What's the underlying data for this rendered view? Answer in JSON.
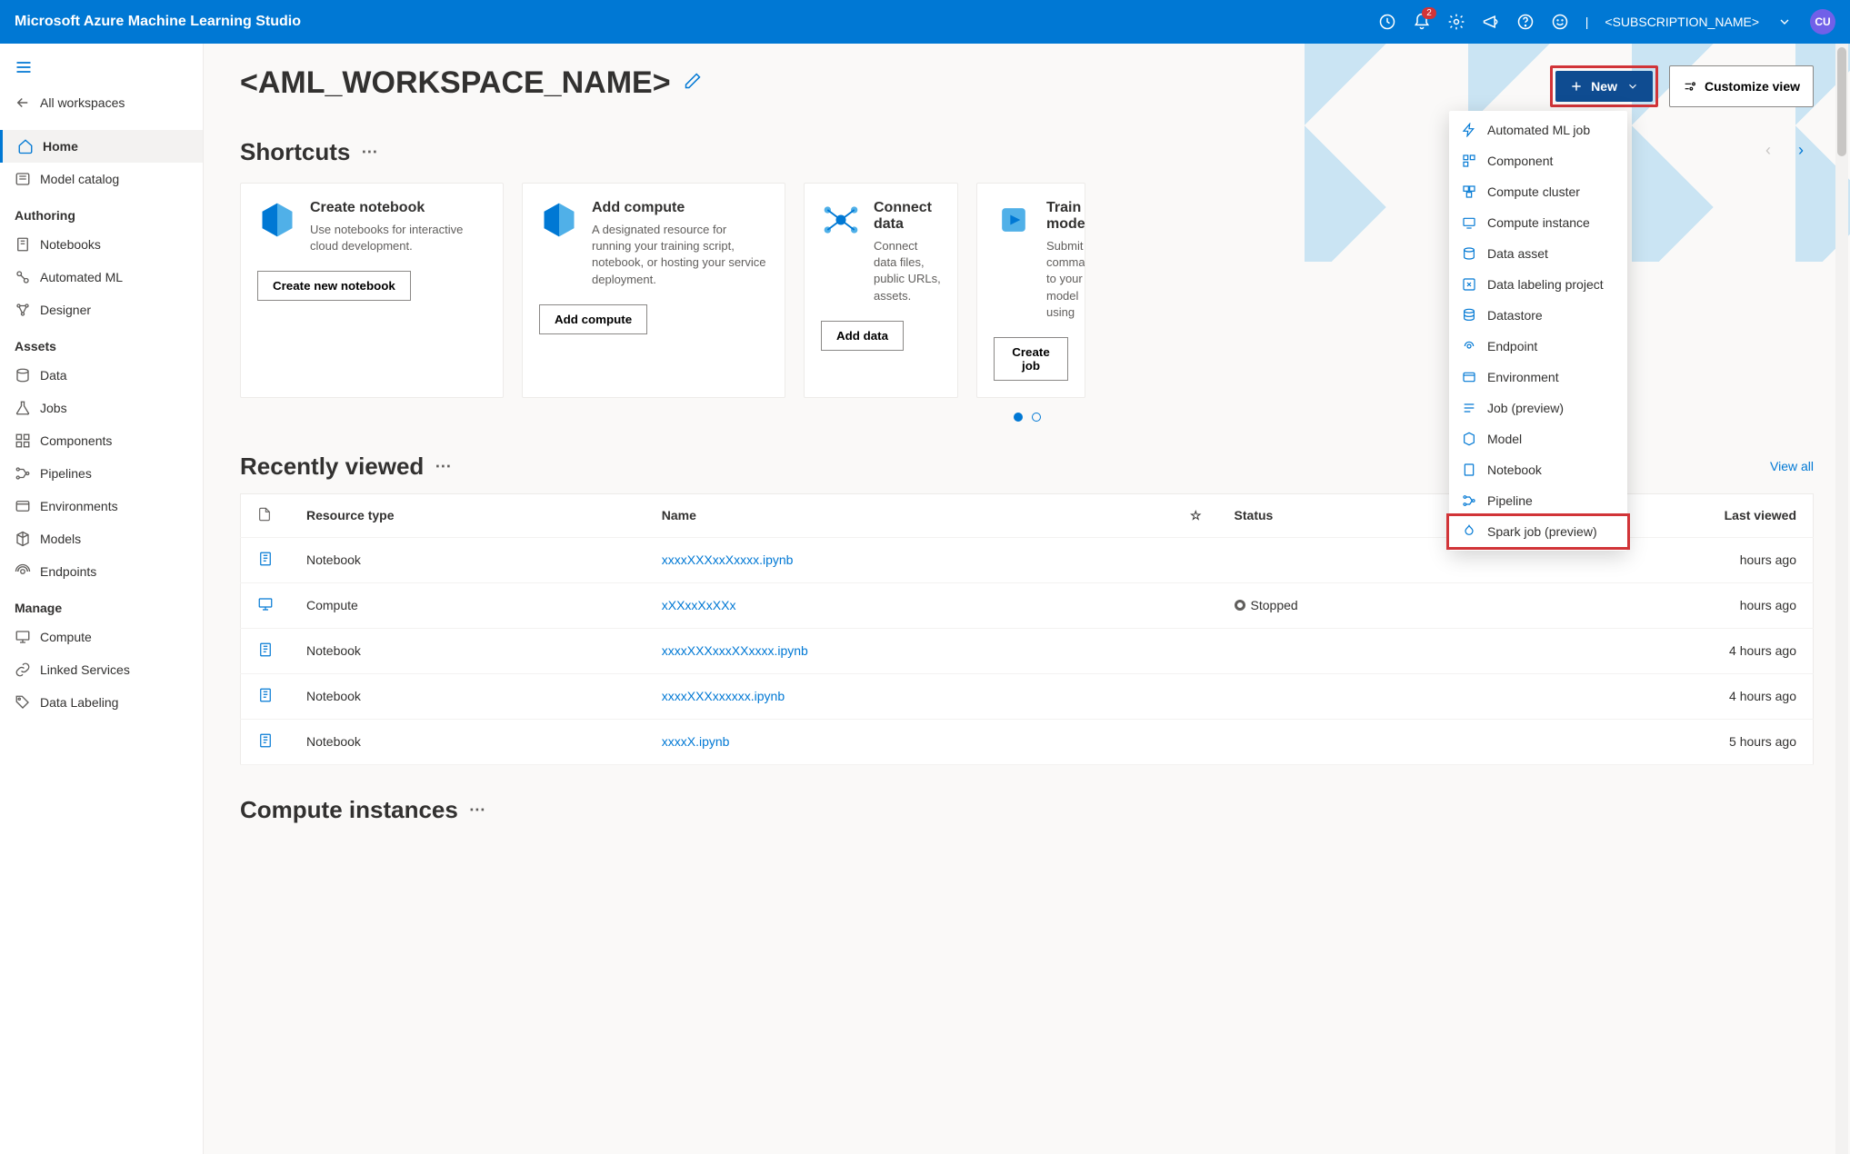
{
  "topbar": {
    "title": "Microsoft Azure Machine Learning Studio",
    "notification_count": "2",
    "subscription": "<SUBSCRIPTION_NAME>",
    "avatar_initials": "CU"
  },
  "sidebar": {
    "back": "All workspaces",
    "home": "Home",
    "model_catalog": "Model catalog",
    "groups": {
      "authoring": {
        "title": "Authoring",
        "items": [
          "Notebooks",
          "Automated ML",
          "Designer"
        ]
      },
      "assets": {
        "title": "Assets",
        "items": [
          "Data",
          "Jobs",
          "Components",
          "Pipelines",
          "Environments",
          "Models",
          "Endpoints"
        ]
      },
      "manage": {
        "title": "Manage",
        "items": [
          "Compute",
          "Linked Services",
          "Data Labeling"
        ]
      }
    }
  },
  "workspace": {
    "name": "<AML_WORKSPACE_NAME>"
  },
  "buttons": {
    "new": "New",
    "customize": "Customize view"
  },
  "shortcuts": {
    "title": "Shortcuts",
    "cards": [
      {
        "title": "Create notebook",
        "desc": "Use notebooks for interactive cloud development.",
        "btn": "Create new notebook"
      },
      {
        "title": "Add compute",
        "desc": "A designated resource for running your training script, notebook, or hosting your service deployment.",
        "btn": "Add compute"
      },
      {
        "title": "Connect data",
        "desc": "Connect data files, public URLs, assets.",
        "btn": "Add data"
      },
      {
        "title": "Train a model",
        "desc": "Submit a command to your model using",
        "btn": "Create job"
      }
    ]
  },
  "new_menu": [
    "Automated ML job",
    "Component",
    "Compute cluster",
    "Compute instance",
    "Data asset",
    "Data labeling project",
    "Datastore",
    "Endpoint",
    "Environment",
    "Job (preview)",
    "Model",
    "Notebook",
    "Pipeline",
    "Spark job (preview)"
  ],
  "recent": {
    "title": "Recently viewed",
    "view_all": "View all",
    "columns": {
      "type": "Resource type",
      "name": "Name",
      "status": "Status",
      "last": "Last viewed"
    },
    "rows": [
      {
        "icon": "notebook",
        "type": "Notebook",
        "name": "xxxxXXXxxXxxxx.ipynb",
        "status": "",
        "last": "hours ago"
      },
      {
        "icon": "compute",
        "type": "Compute",
        "name": "xXXxxXxXXx",
        "status": "Stopped",
        "last": "hours ago"
      },
      {
        "icon": "notebook",
        "type": "Notebook",
        "name": "xxxxXXXxxxXXxxxx.ipynb",
        "status": "",
        "last": "4 hours ago"
      },
      {
        "icon": "notebook",
        "type": "Notebook",
        "name": "xxxxXXXxxxxxx.ipynb",
        "status": "",
        "last": "4 hours ago"
      },
      {
        "icon": "notebook",
        "type": "Notebook",
        "name": "xxxxX.ipynb",
        "status": "",
        "last": "5 hours ago"
      }
    ]
  },
  "compute_instances": {
    "title": "Compute instances"
  }
}
